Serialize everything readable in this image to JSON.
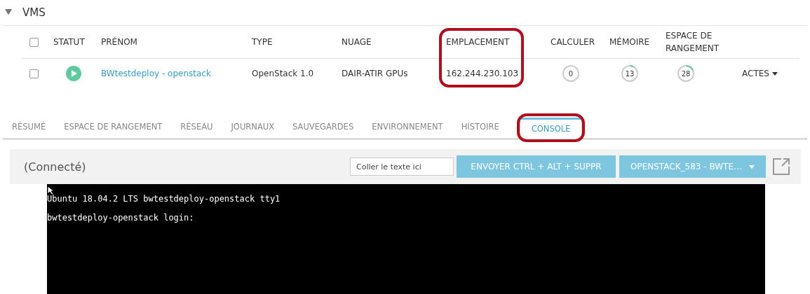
{
  "section": {
    "title": "VMS",
    "expanded": true
  },
  "table": {
    "columns": [
      {
        "label": "STATUT",
        "highlighted": false
      },
      {
        "label": "PRÉNOM",
        "highlighted": false
      },
      {
        "label": "TYPE",
        "highlighted": false
      },
      {
        "label": "NUAGE",
        "highlighted": false
      },
      {
        "label": "EMPLACEMENT",
        "highlighted": true
      },
      {
        "label": "CALCULER",
        "highlighted": false
      },
      {
        "label": "MÉMOIRE",
        "highlighted": false
      },
      {
        "label": "ESPACE DE RANGEMENT",
        "highlighted": false
      }
    ],
    "all_checked": false,
    "rows": [
      {
        "checked": false,
        "status": {
          "kind": "running"
        },
        "name": "BWtestdeploy - openstack",
        "type": "OpenStack 1.0",
        "cloud": "DAIR-ATIR GPUs",
        "location": "162.244.230.103",
        "compute": {
          "value": "0",
          "level": 0
        },
        "memory": {
          "value": "13",
          "level": 0.08
        },
        "storage": {
          "value": "28",
          "level": 0.18
        },
        "actions": "ACTES"
      }
    ]
  },
  "tabs": [
    {
      "label": "RÉSUMÉ",
      "selected": false,
      "highlighted": false
    },
    {
      "label": "ESPACE DE RANGEMENT",
      "selected": false,
      "highlighted": false
    },
    {
      "label": "RÉSEAU",
      "selected": false,
      "highlighted": false
    },
    {
      "label": "JOURNAUX",
      "selected": false,
      "highlighted": false
    },
    {
      "label": "SAUVEGARDES",
      "selected": false,
      "highlighted": false
    },
    {
      "label": "ENVIRONNEMENT",
      "selected": false,
      "highlighted": false
    },
    {
      "label": "HISTOIRE",
      "selected": false,
      "highlighted": false
    },
    {
      "label": "CONSOLE",
      "selected": true,
      "highlighted": true
    }
  ],
  "console": {
    "status": "(Connecté)",
    "paste_field": {
      "placeholder": "Coller le texte ici"
    },
    "send_button": "ENVOYER CTRL + ALT + SUPPR",
    "target_dropdown": "OPENSTACK_583 - BWTE…",
    "screen_lines": [
      "Ubuntu 18.04.2 LTS bwtestdeploy-openstack tty1",
      "bwtestdeploy-openstack login:"
    ]
  }
}
